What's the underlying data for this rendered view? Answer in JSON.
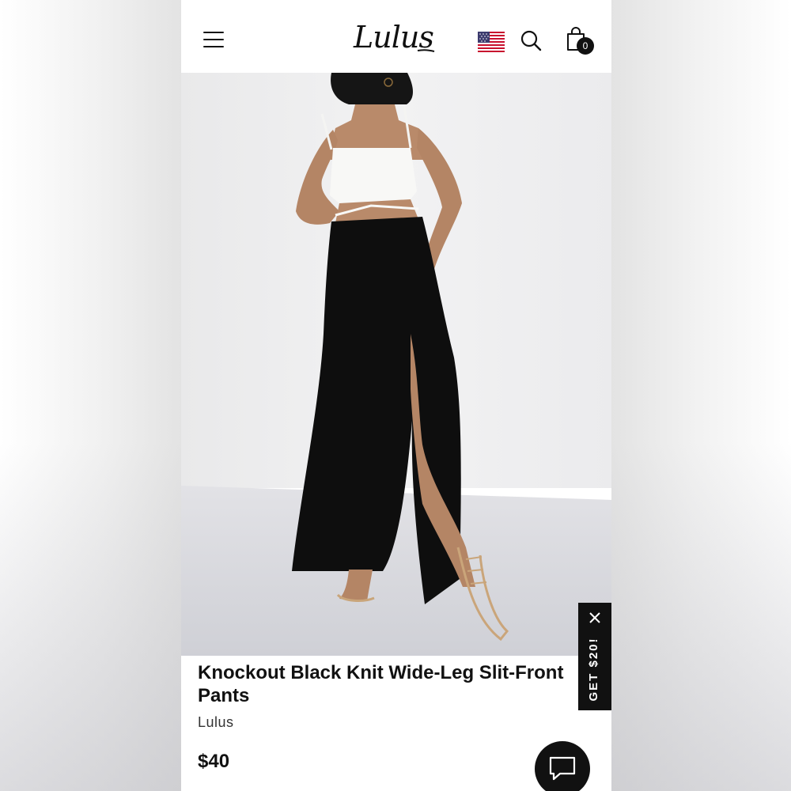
{
  "header": {
    "logo_text": "Lulus",
    "menu_icon": "hamburger-menu-icon",
    "flag_icon": "us-flag-icon",
    "search_icon": "search-icon",
    "bag_icon": "shopping-bag-icon",
    "bag_count": "0"
  },
  "gallery": {
    "total_images": 4,
    "active_index": 0
  },
  "promo": {
    "label": "GET $20!",
    "close_icon": "close-icon"
  },
  "product": {
    "title": "Knockout Black Knit Wide-Leg Slit-Front Pants",
    "brand": "Lulus",
    "price": "$40"
  },
  "chat": {
    "icon": "chat-bubble-icon"
  },
  "colors": {
    "text": "#111111",
    "promo_bg": "#111111",
    "page_bg": "#ffffff"
  }
}
